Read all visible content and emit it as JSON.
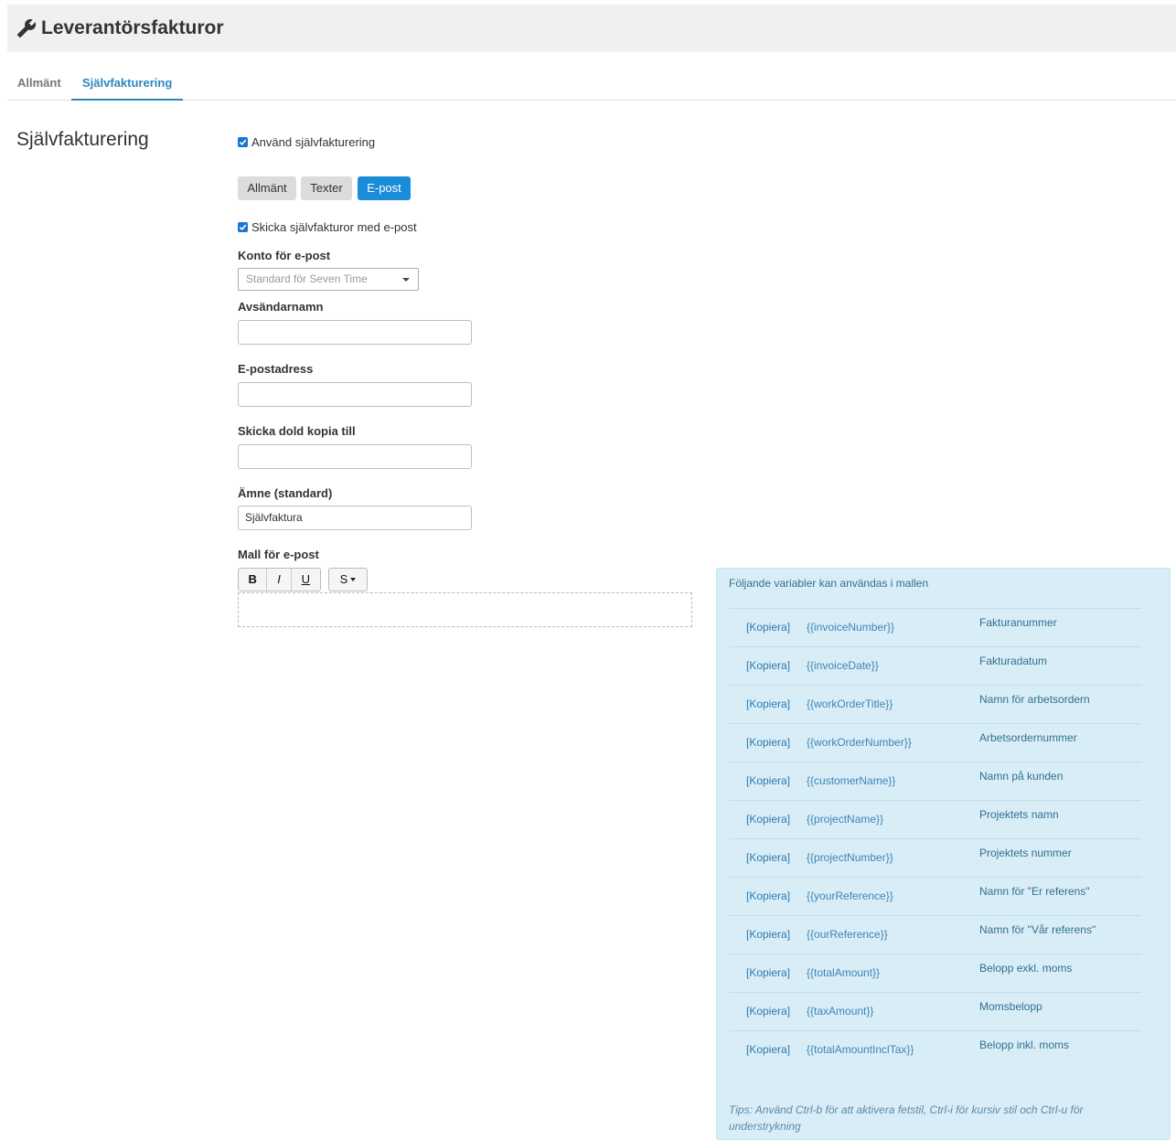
{
  "header": {
    "title": "Leverantörsfakturor",
    "icon": "wrench-icon"
  },
  "tabs": [
    {
      "label": "Allmänt",
      "active": false
    },
    {
      "label": "Självfakturering",
      "active": true
    }
  ],
  "section": {
    "title": "Självfakturering"
  },
  "use_selfbilling": {
    "label": "Använd självfakturering",
    "checked": true
  },
  "subtabs": [
    {
      "label": "Allmänt",
      "active": false
    },
    {
      "label": "Texter",
      "active": false
    },
    {
      "label": "E-post",
      "active": true
    }
  ],
  "send_email": {
    "label": "Skicka självfakturor med e-post",
    "checked": true
  },
  "form": {
    "account": {
      "label": "Konto för e-post",
      "value": "Standard för Seven Time"
    },
    "sender_name": {
      "label": "Avsändarnamn",
      "value": ""
    },
    "email": {
      "label": "E-postadress",
      "value": ""
    },
    "bcc": {
      "label": "Skicka dold kopia till",
      "value": ""
    },
    "subject": {
      "label": "Ämne (standard)",
      "value": "Självfaktura"
    },
    "template": {
      "label": "Mall för e-post"
    }
  },
  "editor": {
    "bold": "B",
    "italic": "I",
    "underline": "U",
    "style": "S"
  },
  "variables": {
    "heading": "Följande variabler kan användas i mallen",
    "copy_label": "[Kopiera]",
    "items": [
      {
        "name": "{{invoiceNumber}}",
        "desc": "Fakturanummer"
      },
      {
        "name": "{{invoiceDate}}",
        "desc": "Fakturadatum"
      },
      {
        "name": "{{workOrderTitle}}",
        "desc": "Namn för arbetsordern"
      },
      {
        "name": "{{workOrderNumber}}",
        "desc": "Arbetsordernummer"
      },
      {
        "name": "{{customerName}}",
        "desc": "Namn på kunden"
      },
      {
        "name": "{{projectName}}",
        "desc": "Projektets namn"
      },
      {
        "name": "{{projectNumber}}",
        "desc": "Projektets nummer"
      },
      {
        "name": "{{yourReference}}",
        "desc": "Namn för \"Er referens\""
      },
      {
        "name": "{{ourReference}}",
        "desc": "Namn för \"Vår referens\""
      },
      {
        "name": "{{totalAmount}}",
        "desc": "Belopp exkl. moms"
      },
      {
        "name": "{{taxAmount}}",
        "desc": "Momsbelopp"
      },
      {
        "name": "{{totalAmountInclTax}}",
        "desc": "Belopp inkl. moms"
      }
    ],
    "tips": "Tips: Använd Ctrl-b för att aktivera fetstil, Ctrl-i för kursiv stil och Ctrl-u för understrykning"
  }
}
